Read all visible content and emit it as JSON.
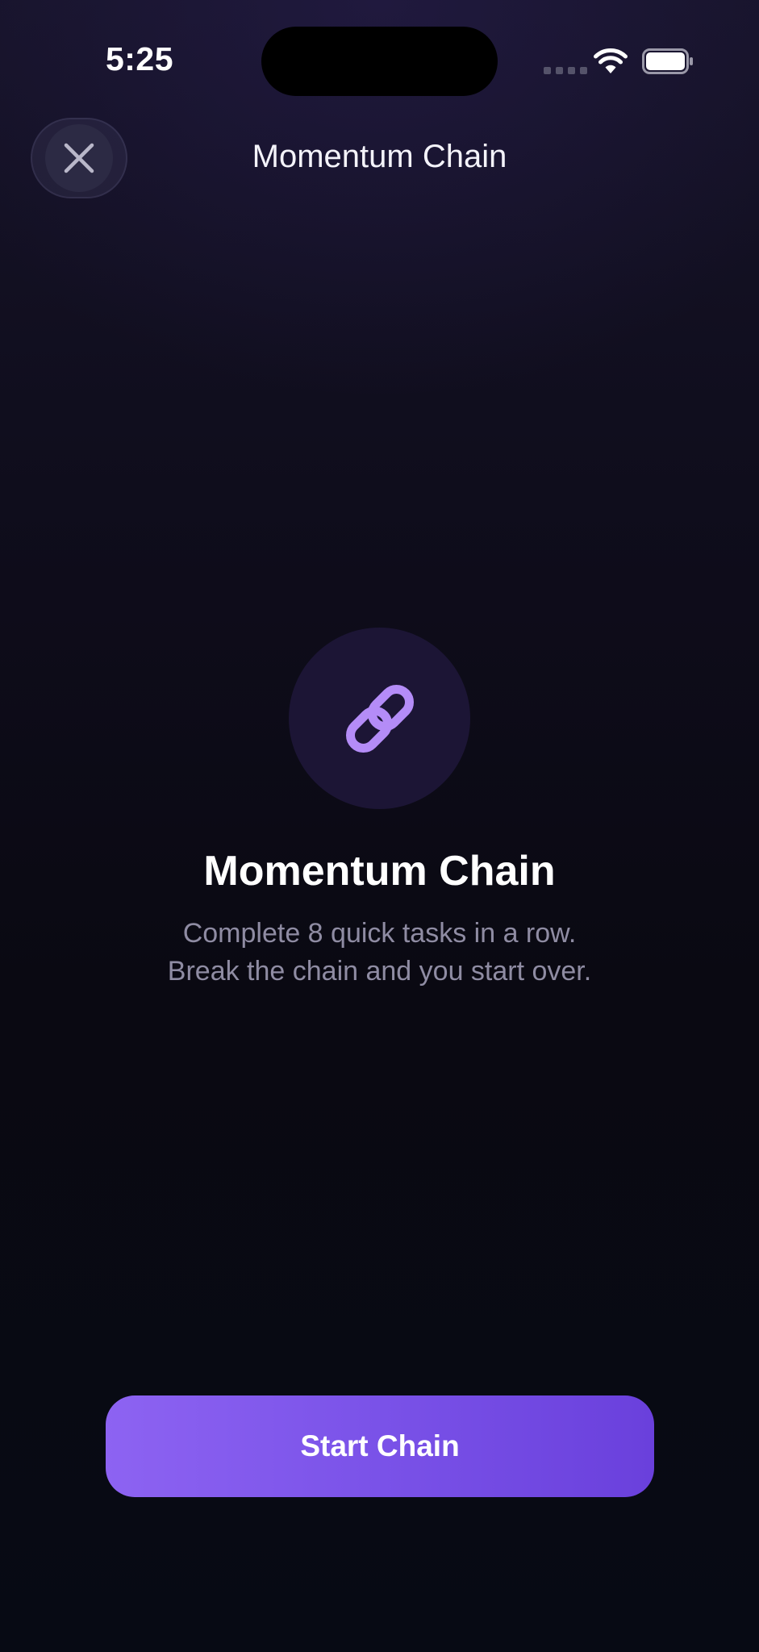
{
  "status_bar": {
    "time": "5:25",
    "icons": [
      "cellular-signal-icon",
      "wifi-icon",
      "battery-icon"
    ]
  },
  "header": {
    "title": "Momentum Chain",
    "close_icon": "close-icon"
  },
  "hero": {
    "icon": "link-icon",
    "title": "Momentum Chain",
    "description_lines": [
      "Complete 8 quick tasks in a row.",
      "Break the chain and you start over."
    ]
  },
  "cta": {
    "label": "Start Chain"
  },
  "colors": {
    "accent": "#8d63f2",
    "accent_dark": "#6a40dc",
    "icon_tint": "#b48cf7",
    "icon_circle": "#1c1535",
    "secondary_text": "#8f8ca3",
    "background": "#0b0a14"
  }
}
